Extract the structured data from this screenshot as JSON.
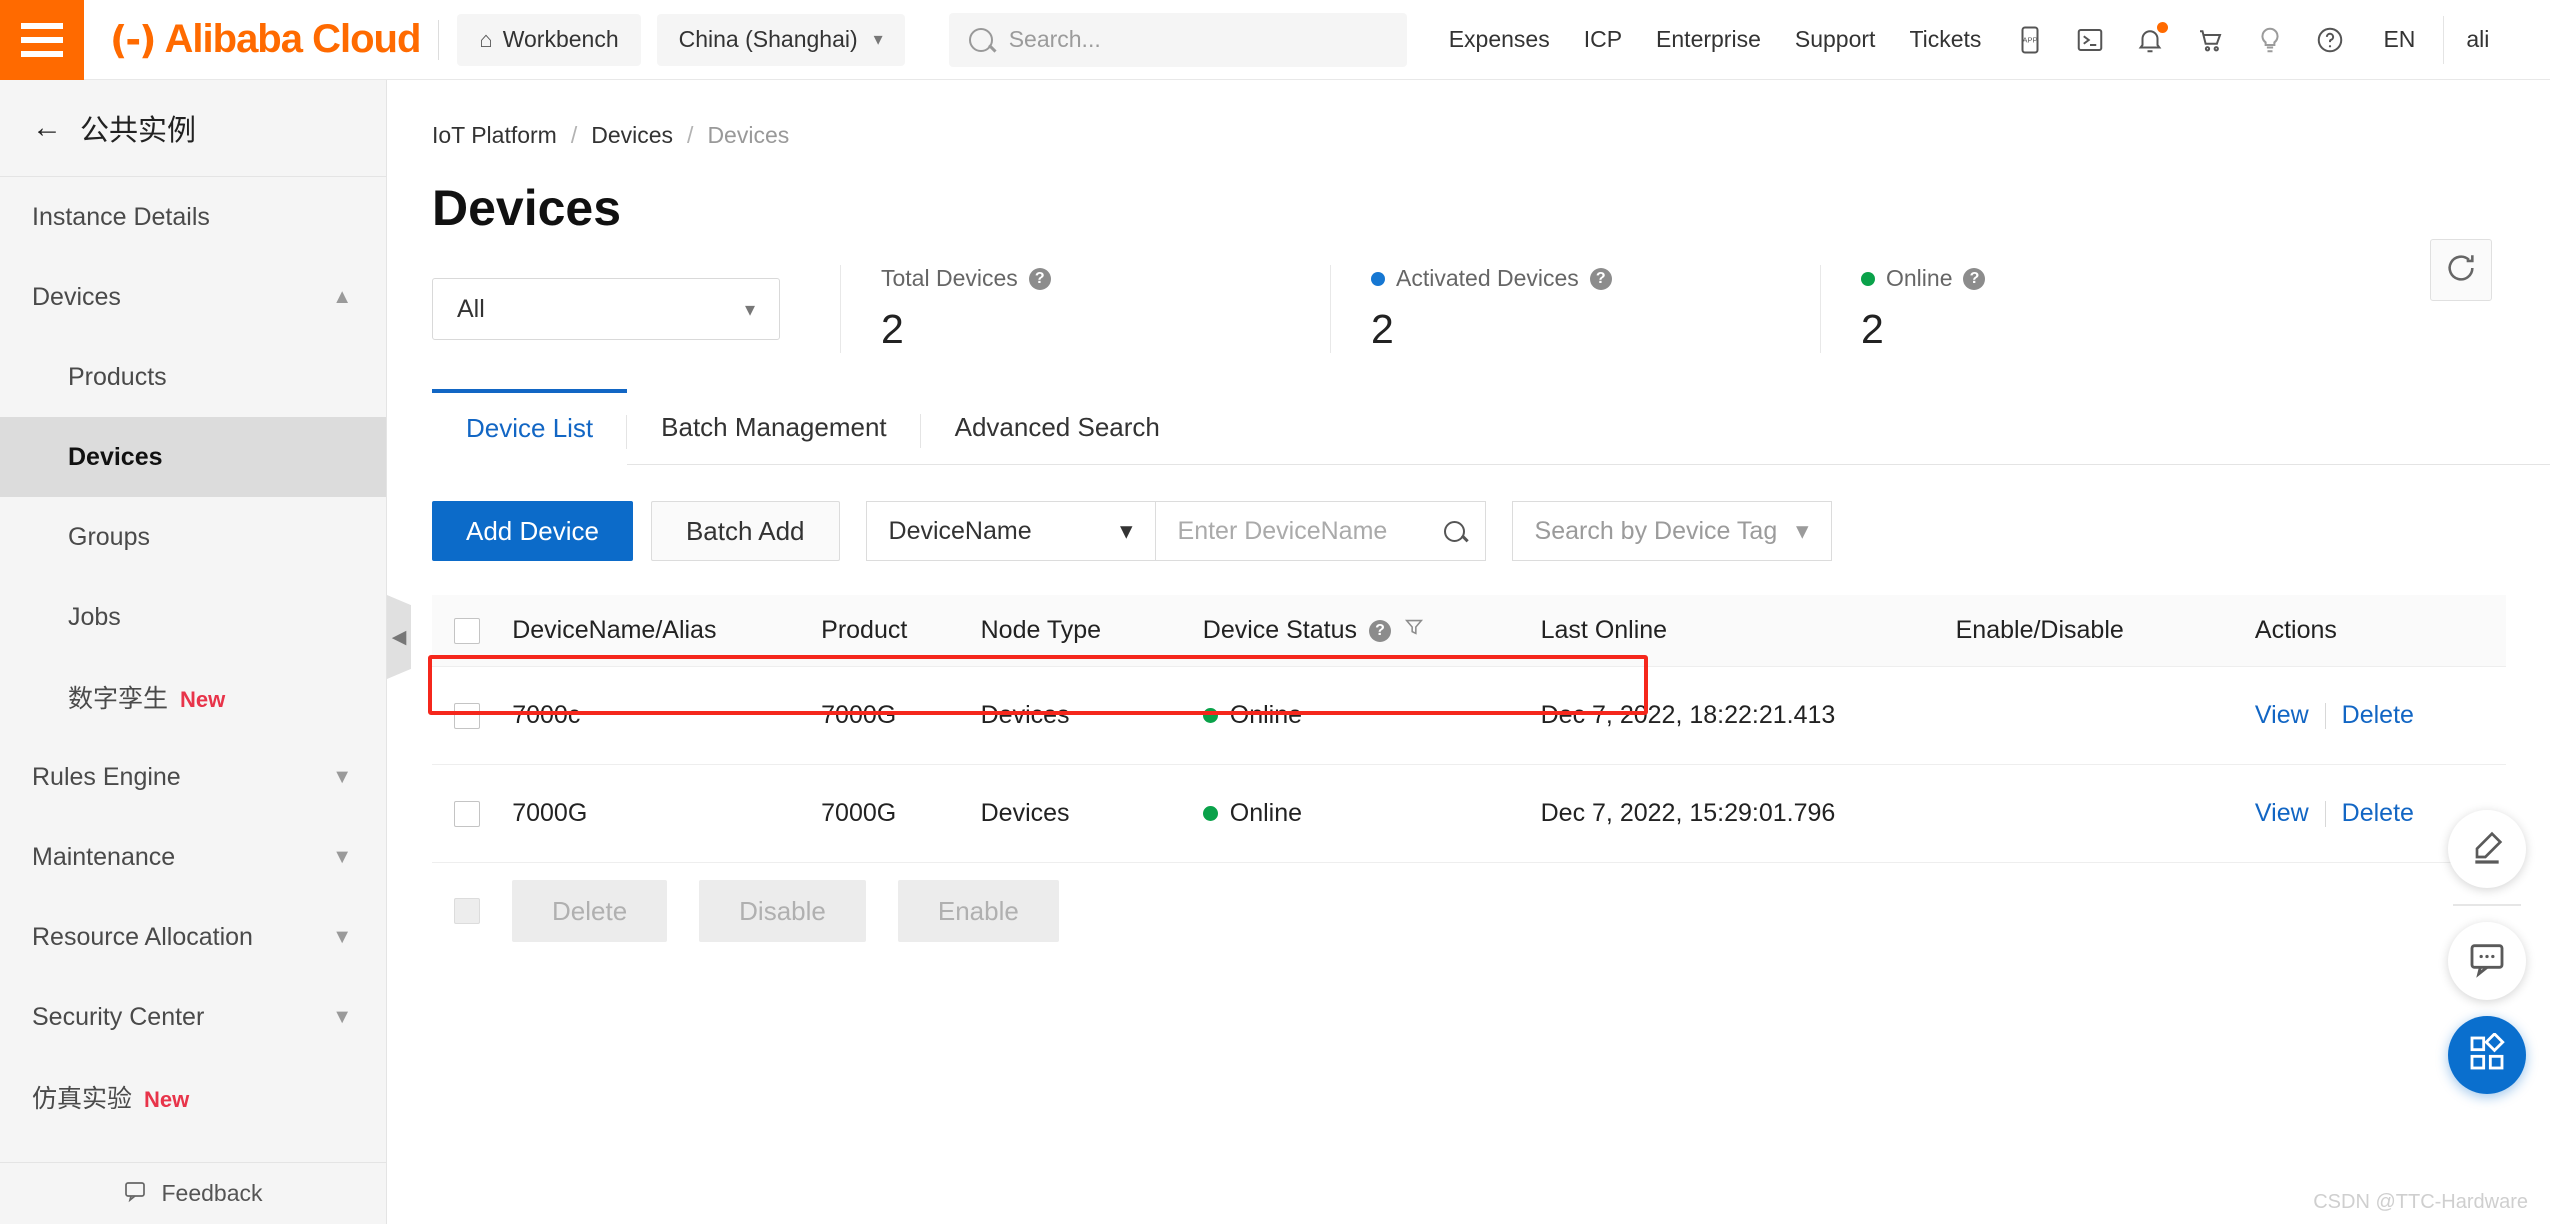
{
  "topbar": {
    "menu_icon": "hamburger-icon",
    "brand_mark": "(-)",
    "brand": "Alibaba Cloud",
    "workbench": "Workbench",
    "region": "China (Shanghai)",
    "search_placeholder": "Search...",
    "nav": [
      "Expenses",
      "ICP",
      "Enterprise",
      "Support",
      "Tickets"
    ],
    "icons": [
      "app-icon",
      "console-terminal-icon",
      "bell-icon",
      "cart-icon",
      "lightbulb-icon",
      "help-circle-icon"
    ],
    "lang": "EN",
    "account": "ali"
  },
  "sidebar": {
    "header": "公共实例",
    "items": [
      {
        "label": "Instance Details",
        "level": "top",
        "chevron": "",
        "active": false,
        "badge": ""
      },
      {
        "label": "Devices",
        "level": "top",
        "chevron": "up",
        "active": false,
        "badge": ""
      },
      {
        "label": "Products",
        "level": "sub",
        "chevron": "",
        "active": false,
        "badge": ""
      },
      {
        "label": "Devices",
        "level": "sub",
        "chevron": "",
        "active": true,
        "badge": ""
      },
      {
        "label": "Groups",
        "level": "sub",
        "chevron": "",
        "active": false,
        "badge": ""
      },
      {
        "label": "Jobs",
        "level": "sub",
        "chevron": "",
        "active": false,
        "badge": ""
      },
      {
        "label": "数字孪生",
        "level": "sub",
        "chevron": "",
        "active": false,
        "badge": "New"
      },
      {
        "label": "Rules Engine",
        "level": "top",
        "chevron": "down",
        "active": false,
        "badge": ""
      },
      {
        "label": "Maintenance",
        "level": "top",
        "chevron": "down",
        "active": false,
        "badge": ""
      },
      {
        "label": "Resource Allocation",
        "level": "top",
        "chevron": "down",
        "active": false,
        "badge": ""
      },
      {
        "label": "Security Center",
        "level": "top",
        "chevron": "down",
        "active": false,
        "badge": ""
      },
      {
        "label": "仿真实验",
        "level": "top",
        "chevron": "",
        "active": false,
        "badge": "New"
      }
    ],
    "feedback": "Feedback"
  },
  "breadcrumb": {
    "items": [
      "IoT Platform",
      "Devices",
      "Devices"
    ],
    "separator": "/"
  },
  "page": {
    "title": "Devices"
  },
  "instance_filter": {
    "value": "All"
  },
  "stats": [
    {
      "label": "Total Devices",
      "value": "2",
      "dot_color": "",
      "help": "?"
    },
    {
      "label": "Activated Devices",
      "value": "2",
      "dot_color": "#1677d2",
      "help": "?"
    },
    {
      "label": "Online",
      "value": "2",
      "dot_color": "#0aa24a",
      "help": "?"
    }
  ],
  "refresh_button": "refresh-icon",
  "tabs": [
    {
      "label": "Device List",
      "active": true
    },
    {
      "label": "Batch Management",
      "active": false
    },
    {
      "label": "Advanced Search",
      "active": false
    }
  ],
  "toolbar": {
    "add_device": "Add Device",
    "batch_add": "Batch Add",
    "search_field_select": "DeviceName",
    "search_input_placeholder": "Enter  DeviceName",
    "search_input_value": "",
    "tag_select": "Search by Device Tag"
  },
  "table": {
    "columns": [
      "DeviceName/Alias",
      "Product",
      "Node Type",
      "Device Status",
      "Last Online",
      "Enable/Disable",
      "Actions"
    ],
    "rows": [
      {
        "name": "7000c",
        "product": "7000G",
        "node_type": "Devices",
        "status": "Online",
        "status_color": "#0aa24a",
        "last_online": "Dec 7, 2022, 18:22:21.413",
        "enabled": true,
        "actions": [
          "View",
          "Delete"
        ],
        "highlighted": true
      },
      {
        "name": "7000G",
        "product": "7000G",
        "node_type": "Devices",
        "status": "Online",
        "status_color": "#0aa24a",
        "last_online": "Dec 7, 2022, 15:29:01.796",
        "enabled": true,
        "actions": [
          "View",
          "Delete"
        ],
        "highlighted": false
      }
    ]
  },
  "batch_actions": [
    "Delete",
    "Disable",
    "Enable"
  ],
  "float_buttons": [
    "pencil-edit-icon",
    "chat-feedback-icon",
    "apps-grid-icon"
  ],
  "watermark": "CSDN @TTC-Hardware",
  "colors": {
    "brand_orange": "#ff6a00",
    "primary_blue": "#0c6bc9",
    "online_green": "#0aa24a",
    "highlight_red": "#f5271c",
    "new_red": "#e8344a"
  }
}
